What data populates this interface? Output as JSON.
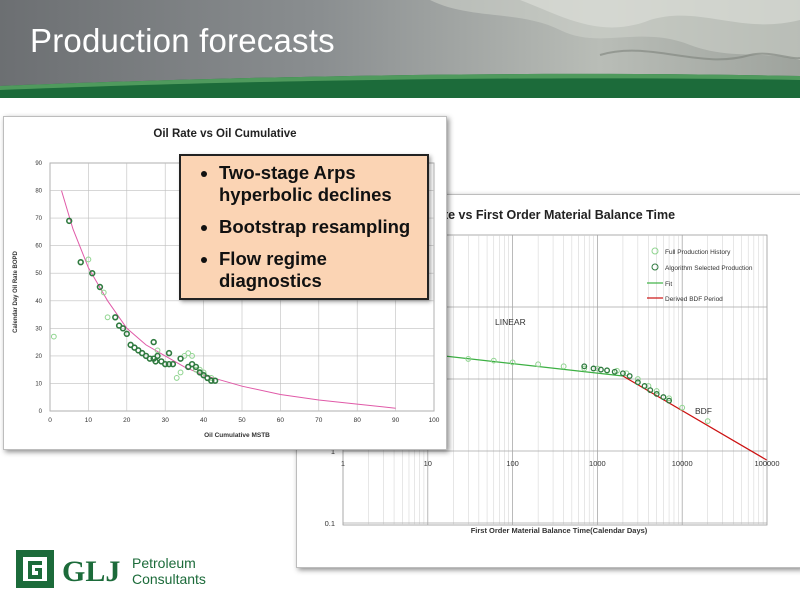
{
  "slide": {
    "title": "Production forecasts",
    "bullets": [
      "Two-stage Arps hyperbolic declines",
      "Bootstrap resampling",
      "Flow regime diagnostics"
    ]
  },
  "logo": {
    "mark": "GLJ",
    "line1": "Petroleum",
    "line2": "Consultants",
    "color": "#1c6b3a"
  },
  "colors": {
    "header_green": "#1c6b3a",
    "callout_fill": "#fbd4b4",
    "fit_magenta": "#e05aa8",
    "fit_green": "#3cb043",
    "bdf_red": "#cc1111",
    "marker_dark": "#2f7a3f",
    "marker_light": "#8fd48f"
  },
  "chart_data": [
    {
      "type": "scatter",
      "title": "Oil Rate vs Oil Cumulative",
      "xlabel": "Oil Cumulative MSTB",
      "ylabel": "Calendar Day Oil Rate BOPD",
      "xlim": [
        0,
        100
      ],
      "ylim": [
        0,
        90
      ],
      "x_ticks": [
        "0",
        "10",
        "20",
        "30",
        "40",
        "50",
        "60",
        "70",
        "80",
        "90",
        "100"
      ],
      "y_ticks": [
        "0",
        "10",
        "20",
        "30",
        "40",
        "50",
        "60",
        "70",
        "80",
        "90"
      ],
      "grid": true,
      "fit": {
        "x": [
          3,
          6,
          10,
          15,
          20,
          25,
          30,
          35,
          40,
          45,
          50,
          60,
          70,
          80,
          90
        ],
        "y": [
          80,
          66,
          52,
          40,
          30,
          24,
          20,
          16,
          13,
          11,
          9,
          6,
          4,
          2.5,
          1
        ]
      },
      "points_dark": {
        "x": [
          5,
          8,
          11,
          13,
          17,
          18,
          19,
          20,
          21,
          22,
          23,
          24,
          25,
          26,
          27,
          27.5,
          28,
          29,
          30,
          31,
          32,
          34,
          36,
          37,
          38,
          39,
          40,
          41,
          42,
          43,
          27,
          31
        ],
        "y": [
          69,
          54,
          50,
          45,
          34,
          31,
          30,
          28,
          24,
          23,
          22,
          21,
          20,
          19,
          19,
          18,
          20,
          18,
          17,
          17,
          17,
          19,
          16,
          17,
          16,
          14,
          13,
          12,
          11,
          11,
          25,
          21
        ]
      },
      "points_light": {
        "x": [
          1,
          8,
          10,
          14,
          15,
          28,
          30,
          33,
          34,
          35,
          36,
          37,
          38,
          39,
          40,
          42
        ],
        "y": [
          27,
          54,
          55,
          43,
          34,
          22,
          17,
          12,
          14,
          20,
          21,
          20,
          15,
          15,
          14,
          12
        ]
      }
    },
    {
      "type": "scatter",
      "title": "ate vs First Order Material Balance Time",
      "xlabel": "First Order Material Balance Time(Calendar Days)",
      "x_scale": "log",
      "y_scale": "log",
      "xlim": [
        1,
        100000
      ],
      "x_ticks": [
        "1",
        "10",
        "100",
        "1000",
        "10000",
        "100000"
      ],
      "y_ticks_visible": [
        "1",
        "0.1"
      ],
      "grid": true,
      "legend": {
        "position": "top-right",
        "entries": [
          "Full Production History",
          "Algorithm Selected Production",
          "Fit",
          "Derived BDF Period"
        ]
      },
      "annotations": [
        "LINEAR",
        "BDF"
      ],
      "linear_fit": {
        "x": [
          1,
          2000
        ],
        "y": [
          30,
          11
        ]
      },
      "bdf_line": {
        "x": [
          2000,
          200000
        ],
        "y": [
          11,
          0.75
        ]
      },
      "points_light": {
        "x": [
          1.5,
          3,
          5,
          8,
          15,
          30,
          60,
          100,
          200,
          400,
          700,
          1000,
          1300,
          1700,
          2200,
          3000,
          4000,
          5000,
          7000,
          10000,
          20000
        ],
        "y": [
          28,
          24,
          22,
          21,
          20,
          19,
          18,
          17,
          16,
          15,
          14,
          14,
          13,
          13,
          12,
          10,
          8,
          6.8,
          5.4,
          4,
          2.6
        ]
      },
      "points_dark": {
        "x": [
          700,
          900,
          1100,
          1300,
          1600,
          2000,
          2400,
          3000,
          3600,
          4200,
          5000,
          6000,
          7000
        ],
        "y": [
          15,
          14,
          13.5,
          13.2,
          12.6,
          12,
          11,
          9,
          8,
          7,
          6.2,
          5.6,
          5
        ]
      }
    }
  ]
}
